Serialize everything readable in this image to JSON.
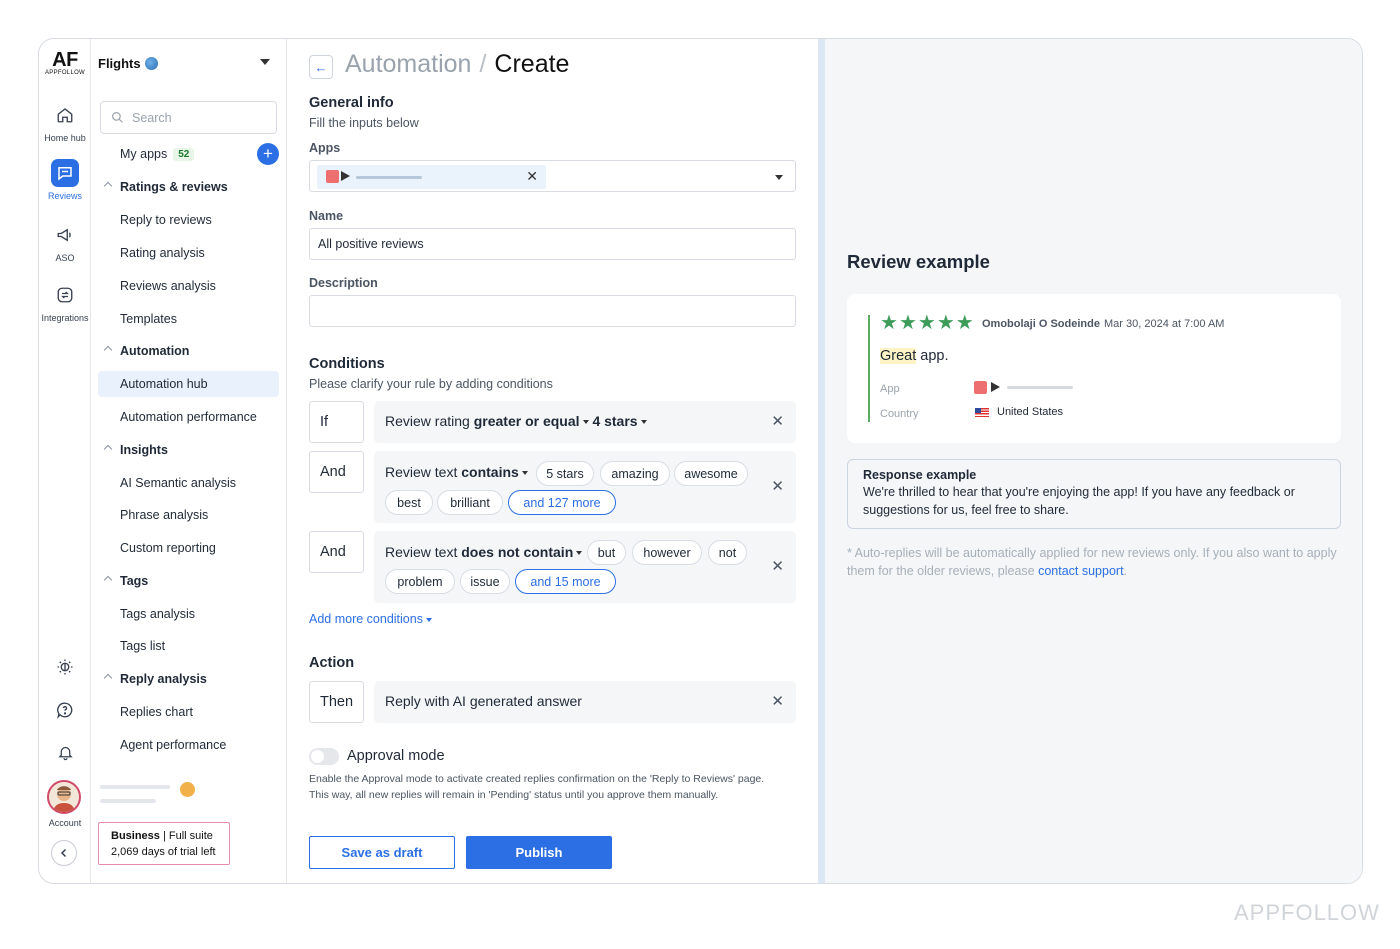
{
  "brand": {
    "logo": "AF",
    "logo_sub": "APPFOLLOW",
    "watermark": "APPFOLLOW",
    "accent": "#2c6fe4"
  },
  "rail": {
    "items": [
      {
        "label": "Home hub",
        "icon": "home-icon"
      },
      {
        "label": "Reviews",
        "icon": "reviews-icon",
        "active": true
      },
      {
        "label": "ASO",
        "icon": "megaphone-icon"
      },
      {
        "label": "Integrations",
        "icon": "integrations-icon"
      }
    ],
    "bottom_icons": [
      "theme-icon",
      "help-icon",
      "bell-icon"
    ],
    "account_label": "Account"
  },
  "sidebar": {
    "app_name": "Flights",
    "search_placeholder": "Search",
    "my_apps_label": "My apps",
    "my_apps_count": "52",
    "groups": {
      "ratings": {
        "label": "Ratings & reviews",
        "items": [
          "Reply to reviews",
          "Rating analysis",
          "Reviews analysis",
          "Templates"
        ]
      },
      "automation": {
        "label": "Automation",
        "items": [
          "Automation hub",
          "Automation performance"
        ],
        "active": "Automation hub"
      },
      "insights": {
        "label": "Insights",
        "items": [
          "AI Semantic analysis",
          "Phrase analysis",
          "Custom reporting"
        ]
      },
      "tags": {
        "label": "Tags",
        "items": [
          "Tags analysis",
          "Tags list"
        ]
      },
      "reply": {
        "label": "Reply analysis",
        "items": [
          "Replies chart",
          "Agent performance"
        ]
      }
    },
    "trial": {
      "plan": "Business",
      "suite": "Full suite",
      "days": "2,069 days of trial left"
    }
  },
  "header": {
    "breadcrumb_parent": "Automation",
    "separator": "/",
    "current": "Create"
  },
  "general": {
    "title": "General info",
    "subtitle": "Fill the inputs below",
    "apps_label": "Apps",
    "name_label": "Name",
    "name_value": "All positive reviews",
    "description_label": "Description",
    "description_value": ""
  },
  "conditions": {
    "title": "Conditions",
    "subtitle": "Please clarify your rule by adding conditions",
    "rules": [
      {
        "tag": "If",
        "field": "Review rating",
        "operator": "greater or equal",
        "value": "4 stars",
        "pills": [],
        "more": ""
      },
      {
        "tag": "And",
        "field": "Review text",
        "operator": "contains",
        "value": "",
        "pills": [
          "5 stars",
          "amazing",
          "awesome",
          "best",
          "brilliant"
        ],
        "more": "and 127 more"
      },
      {
        "tag": "And",
        "field": "Review text",
        "operator": "does not contain",
        "value": "",
        "pills": [
          "but",
          "however",
          "not",
          "problem",
          "issue"
        ],
        "more": "and 15 more"
      }
    ],
    "add_more": "Add more conditions"
  },
  "action": {
    "title": "Action",
    "tag": "Then",
    "text": "Reply with AI generated answer"
  },
  "approval": {
    "title": "Approval mode",
    "enabled": false,
    "desc1": "Enable the Approval mode to activate created replies confirmation on the 'Reply to Reviews' page.",
    "desc2": "This way, all new replies will remain in 'Pending' status until you approve them manually."
  },
  "buttons": {
    "draft": "Save as draft",
    "publish": "Publish"
  },
  "review_example": {
    "title": "Review example",
    "rating": 5,
    "author": "Omobolaji O Sodeinde",
    "date": "Mar 30, 2024 at 7:00 AM",
    "text_highlight": "Great",
    "text_rest": " app.",
    "app_label": "App",
    "country_label": "Country",
    "country": "United States"
  },
  "response_example": {
    "title": "Response example",
    "text": "We're thrilled to hear that you're enjoying the app! If you have any feedback or suggestions for us, feel free to share."
  },
  "note": {
    "text_line1": "* Auto-replies will be automatically applied for new reviews only. If you also want to apply",
    "text_line2": "them for the older reviews, please ",
    "link": "contact support",
    "end": "."
  }
}
